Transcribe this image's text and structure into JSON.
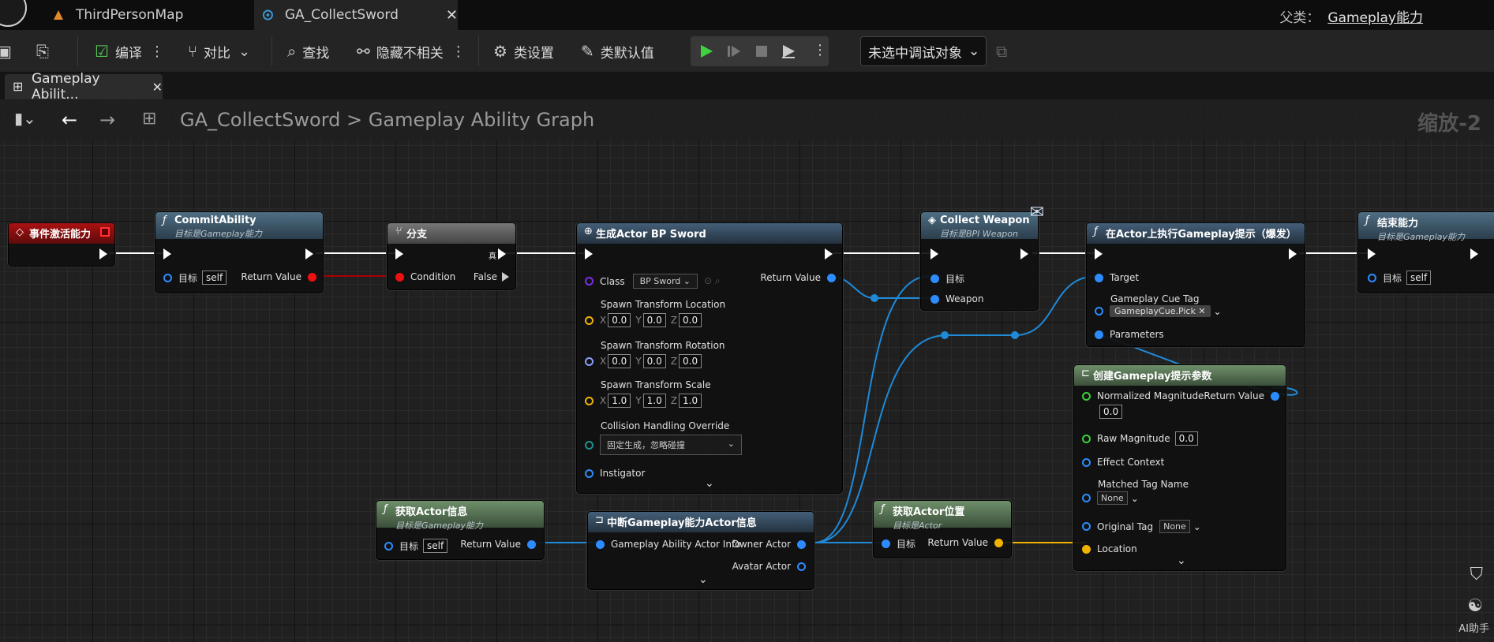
{
  "tabs": [
    {
      "label": "ThirdPersonMap"
    },
    {
      "label": "GA_CollectSword"
    }
  ],
  "parent": {
    "label": "父类：",
    "value": "Gameplay能力"
  },
  "toolbar": {
    "compile": "编译",
    "diff": "对比",
    "find": "查找",
    "hide_unrelated": "隐藏不相关",
    "class_settings": "类设置",
    "class_defaults": "类默认值",
    "debug_target": "未选中调试对象"
  },
  "graph_tab": {
    "label": "Gameplay Abilit..."
  },
  "breadcrumb": {
    "root": "GA_CollectSword",
    "sep": ">",
    "current": "Gameplay Ability Graph"
  },
  "zoom": "缩放-2",
  "nodes": {
    "event": {
      "title": "事件激活能力"
    },
    "commit": {
      "title": "CommitAbility",
      "sub": "目标是Gameplay能力",
      "target": "目标",
      "self": "self",
      "ret": "Return Value"
    },
    "branch": {
      "title": "分支",
      "cond": "Condition",
      "true": "真",
      "false": "False"
    },
    "spawn": {
      "title": "生成Actor BP Sword",
      "class": "Class",
      "class_val": "BP Sword",
      "ret": "Return Value",
      "loc": "Spawn Transform Location",
      "rot": "Spawn Transform Rotation",
      "scale": "Spawn Transform Scale",
      "collision": "Collision Handling Override",
      "collision_val": "固定生成，忽略碰撞",
      "instigator": "Instigator",
      "x": "X",
      "y": "Y",
      "z": "Z",
      "zero": "0.0",
      "one": "1.0"
    },
    "collect": {
      "title": "Collect Weapon",
      "sub": "目标是BPI Weapon",
      "target": "目标",
      "weapon": "Weapon"
    },
    "cue": {
      "title": "在Actor上执行Gameplay提示（爆发）",
      "target": "Target",
      "tag_label": "Gameplay Cue Tag",
      "tag_val": "GameplayCue.Pick",
      "params": "Parameters"
    },
    "end": {
      "title": "结束能力",
      "sub": "目标是Gameplay能力",
      "target": "目标",
      "self": "self"
    },
    "makeparams": {
      "title": "创建Gameplay提示参数",
      "norm": "Normalized Magnitude",
      "norm_val": "0.0",
      "ret": "Return Value",
      "raw": "Raw Magnitude",
      "raw_val": "0.0",
      "ctx": "Effect Context",
      "matched": "Matched Tag Name",
      "none": "None",
      "orig": "Original Tag",
      "loc": "Location"
    },
    "getinfo": {
      "title": "获取Actor信息",
      "sub": "目标是Gameplay能力",
      "target": "目标",
      "self": "self",
      "ret": "Return Value"
    },
    "breakinfo": {
      "title": "中断Gameplay能力Actor信息",
      "in": "Gameplay Ability Actor Info",
      "owner": "Owner Actor",
      "avatar": "Avatar Actor"
    },
    "getloc": {
      "title": "获取Actor位置",
      "sub": "目标是Actor",
      "target": "目标",
      "ret": "Return Value"
    }
  },
  "ai_helper": "AI助手",
  "colors": {
    "exec": "#ffffff",
    "object": "#2c8cff",
    "bool": "#e11111",
    "vector": "#f0b400",
    "float": "#3ccf3c"
  }
}
